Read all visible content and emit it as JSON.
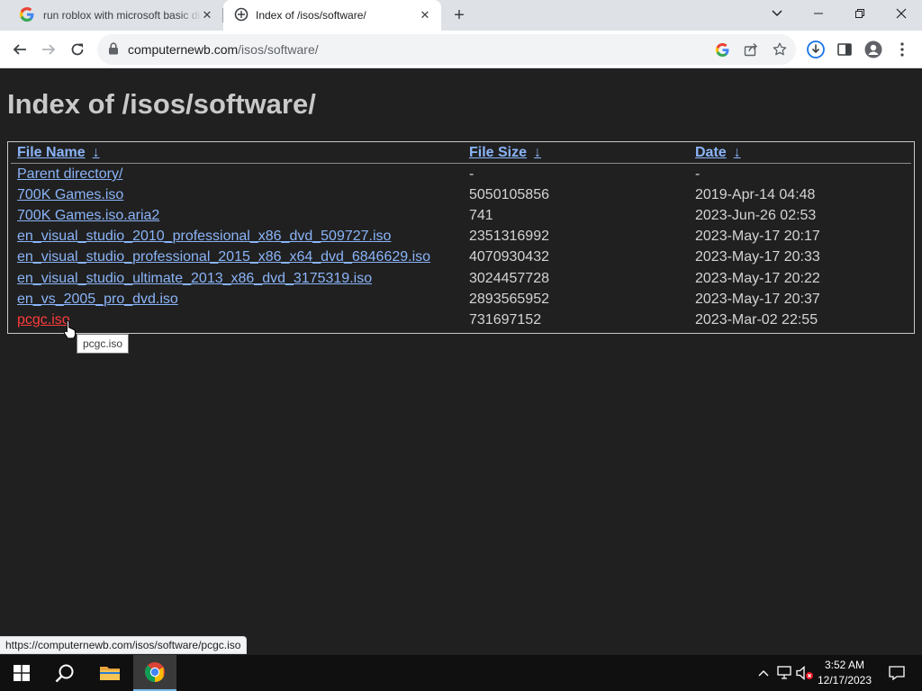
{
  "browser": {
    "tabs": [
      {
        "title": "run roblox with microsoft basic display adapter - Google Search",
        "favicon": "google-g-icon",
        "active": false
      },
      {
        "title": "Index of /isos/software/",
        "favicon": "page-icon",
        "active": true
      }
    ],
    "address": {
      "domain": "computernewb.com",
      "path": "/isos/software/"
    }
  },
  "page": {
    "title": "Index of /isos/software/",
    "headers": {
      "name": "File Name",
      "size": "File Size",
      "date": "Date",
      "sort_indicator": "↓"
    },
    "rows": [
      {
        "name": "Parent directory/",
        "size": "-",
        "date": "-"
      },
      {
        "name": "700K Games.iso",
        "size": "5050105856",
        "date": "2019-Apr-14 04:48"
      },
      {
        "name": "700K Games.iso.aria2",
        "size": "741",
        "date": "2023-Jun-26 02:53"
      },
      {
        "name": "en_visual_studio_2010_professional_x86_dvd_509727.iso",
        "size": "2351316992",
        "date": "2023-May-17 20:17"
      },
      {
        "name": "en_visual_studio_professional_2015_x86_x64_dvd_6846629.iso",
        "size": "4070930432",
        "date": "2023-May-17 20:33"
      },
      {
        "name": "en_visual_studio_ultimate_2013_x86_dvd_3175319.iso",
        "size": "3024457728",
        "date": "2023-May-17 20:22"
      },
      {
        "name": "en_vs_2005_pro_dvd.iso",
        "size": "2893565952",
        "date": "2023-May-17 20:37"
      },
      {
        "name": "pcgc.iso",
        "size": "731697152",
        "date": "2023-Mar-02 22:55",
        "hovered": true
      }
    ],
    "tooltip": "pcgc.iso",
    "status_url": "https://computernewb.com/isos/software/pcgc.iso"
  },
  "taskbar": {
    "time": "3:52 AM",
    "date": "12/17/2023",
    "pinned": [
      "windows-start-icon",
      "search-icon",
      "file-explorer-icon",
      "chrome-icon"
    ]
  },
  "colors": {
    "page_background": "#202020",
    "link": "#8ab4f8",
    "link_hover": "#ff3b3b",
    "text": "#d4d4d4",
    "taskbar": "#101010"
  }
}
